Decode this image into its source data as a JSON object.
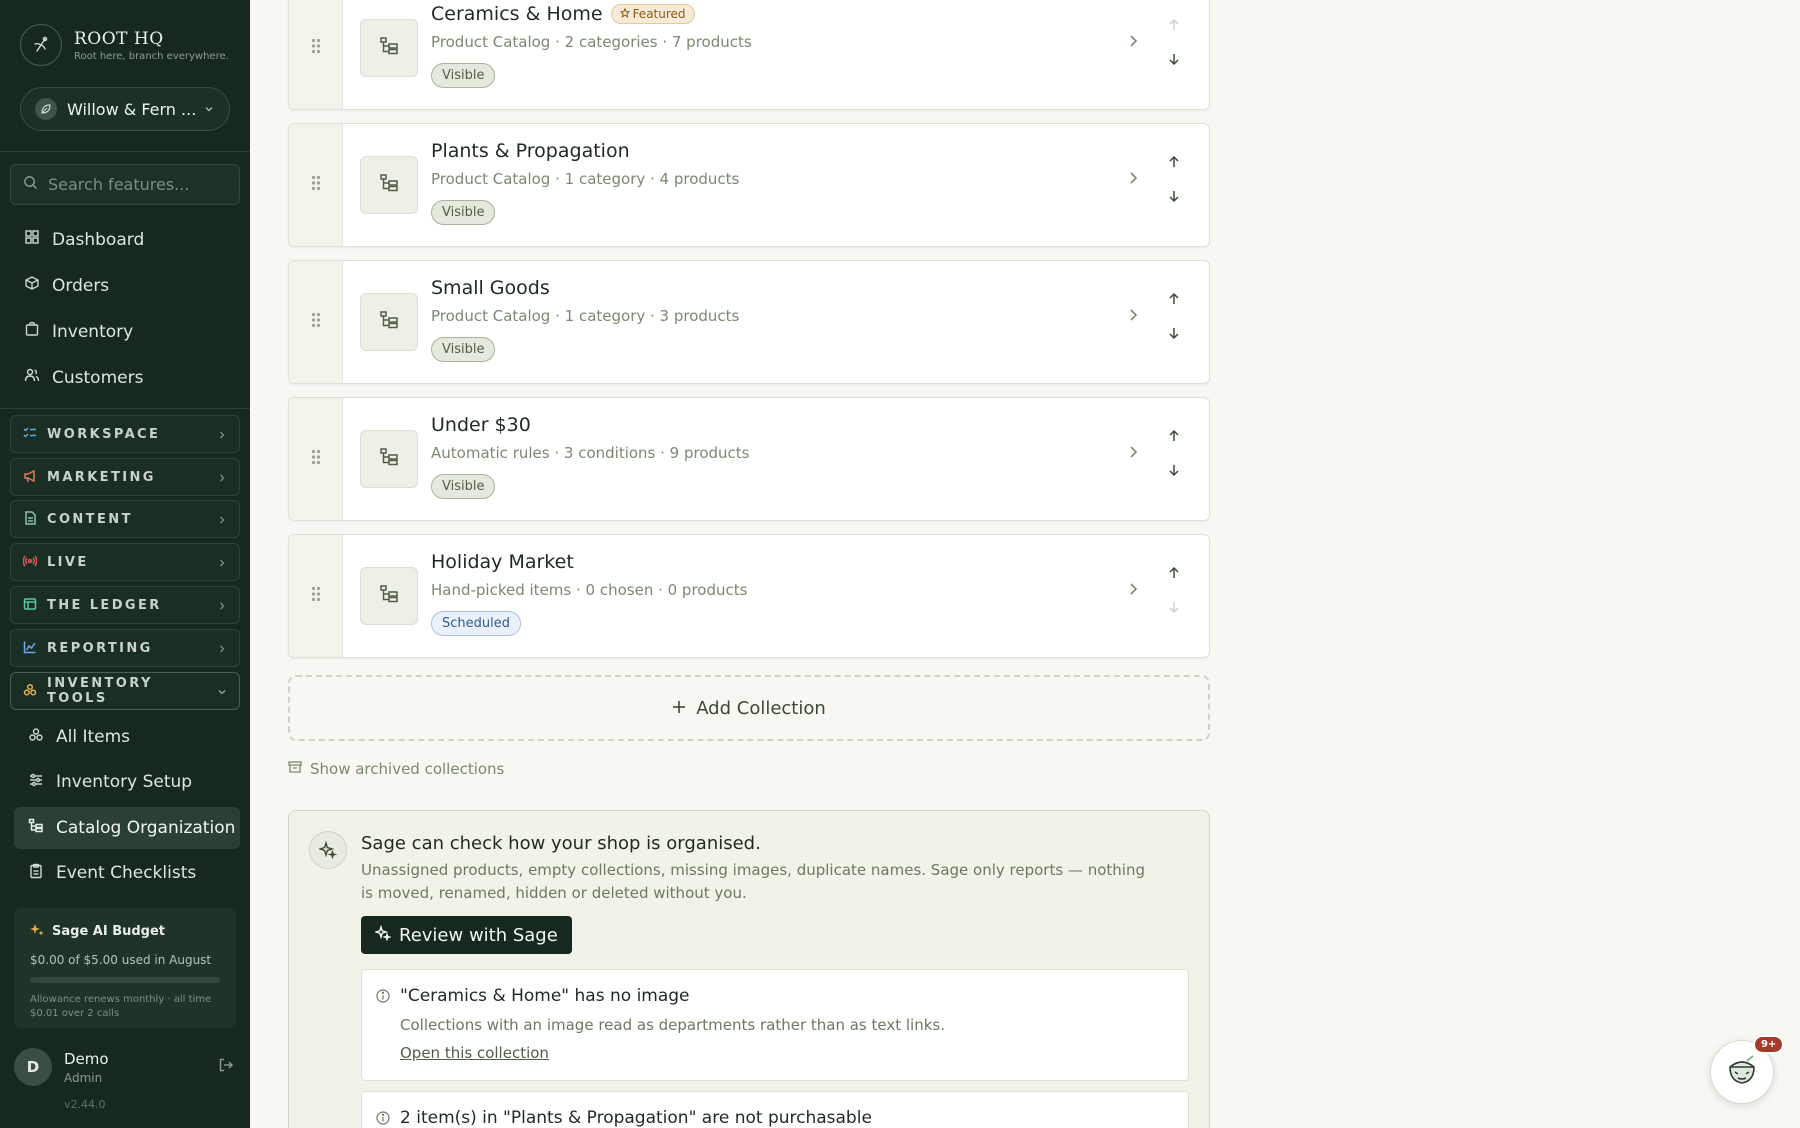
{
  "app": {
    "brand_name": "ROOT HQ",
    "brand_tagline": "Root here, branch everywhere.",
    "store_name": "Willow & Fern ...",
    "version": "v2.44.0"
  },
  "search": {
    "placeholder": "Search features..."
  },
  "nav": [
    {
      "label": "Dashboard",
      "icon": "grid-icon"
    },
    {
      "label": "Orders",
      "icon": "box-icon"
    },
    {
      "label": "Inventory",
      "icon": "bag-icon"
    },
    {
      "label": "Customers",
      "icon": "users-icon"
    }
  ],
  "groups": [
    {
      "label": "WORKSPACE",
      "icon": "checklist-icon",
      "color": "#5aa9e6"
    },
    {
      "label": "MARKETING",
      "icon": "megaphone-icon",
      "color": "#e07a5f"
    },
    {
      "label": "CONTENT",
      "icon": "document-icon",
      "color": "#8fc1a9"
    },
    {
      "label": "LIVE",
      "icon": "broadcast-icon",
      "color": "#e05a5a"
    },
    {
      "label": "THE LEDGER",
      "icon": "ledger-icon",
      "color": "#5fc4a0"
    },
    {
      "label": "REPORTING",
      "icon": "chart-icon",
      "color": "#6fa8e8"
    },
    {
      "label": "INVENTORY TOOLS",
      "icon": "stack-icon",
      "color": "#e8b04a",
      "expanded": true
    }
  ],
  "sub_nav": [
    {
      "label": "All Items",
      "icon": "stack-icon"
    },
    {
      "label": "Inventory Setup",
      "icon": "sliders-icon"
    },
    {
      "label": "Catalog Organization",
      "icon": "tree-icon",
      "active": true
    },
    {
      "label": "Event Checklists",
      "icon": "clipboard-icon"
    }
  ],
  "budget": {
    "title": "Sage AI Budget",
    "used": "$0.00 of $5.00 used in August",
    "used_fraction": 0.0,
    "note": "Allowance renews monthly · all time $0.01 over 2 calls"
  },
  "user": {
    "initial": "D",
    "name": "Demo",
    "role": "Admin"
  },
  "collections": [
    {
      "title": "Ceramics & Home",
      "featured": "Featured",
      "meta": "Product Catalog · 2 categories · 7 products",
      "status": "Visible",
      "status_type": "visible",
      "can_move_up": false,
      "can_move_down": true
    },
    {
      "title": "Plants & Propagation",
      "featured": null,
      "meta": "Product Catalog · 1 category · 4 products",
      "status": "Visible",
      "status_type": "visible",
      "can_move_up": true,
      "can_move_down": true
    },
    {
      "title": "Small Goods",
      "featured": null,
      "meta": "Product Catalog · 1 category · 3 products",
      "status": "Visible",
      "status_type": "visible",
      "can_move_up": true,
      "can_move_down": true
    },
    {
      "title": "Under $30",
      "featured": null,
      "meta": "Automatic rules · 3 conditions · 9 products",
      "status": "Visible",
      "status_type": "visible",
      "can_move_up": true,
      "can_move_down": true
    },
    {
      "title": "Holiday Market",
      "featured": null,
      "meta": "Hand-picked items · 0 chosen · 0 products",
      "status": "Scheduled",
      "status_type": "scheduled",
      "can_move_up": true,
      "can_move_down": false
    }
  ],
  "add_collection_label": "Add Collection",
  "archived_label": "Show archived collections",
  "sage": {
    "title": "Sage can check how your shop is organised.",
    "description": "Unassigned products, empty collections, missing images, duplicate names. Sage only reports — nothing is moved, renamed, hidden or deleted without you.",
    "button": "Review with Sage",
    "findings": [
      {
        "title": "\"Ceramics & Home\" has no image",
        "description": "Collections with an image read as departments rather than as text links.",
        "link": "Open this collection"
      },
      {
        "title": "2 item(s) in \"Plants & Propagation\" are not purchasable",
        "description": "",
        "link": ""
      }
    ]
  },
  "chat": {
    "badge": "9+"
  }
}
